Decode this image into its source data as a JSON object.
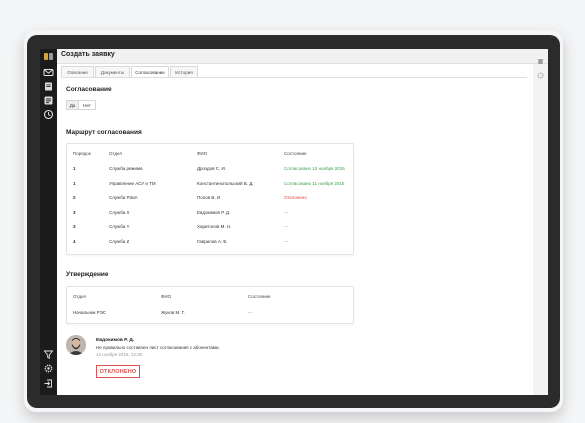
{
  "window": {
    "title": "Создать заявку"
  },
  "tabs": [
    "Описание",
    "Документы",
    "Согласование",
    "История"
  ],
  "active_tab": "Согласование",
  "approval": {
    "heading": "Согласование",
    "toggle": {
      "yes": "Да",
      "no": "Нет",
      "selected": "Да"
    }
  },
  "route": {
    "heading": "Маршрут согласования",
    "columns": [
      "Порядок",
      "Отдел",
      "ФИО",
      "Состояние"
    ],
    "rows": [
      {
        "order": "1",
        "dept": "Служба режима",
        "fio": "Дроздов С. И.",
        "status": "Согласовано 10 ноября 2016"
      },
      {
        "order": "1",
        "dept": "Управление АСУ и ТМ",
        "fio": "Константинопольский В. Д.",
        "status": "Согласовано 11 ноября 2016"
      },
      {
        "order": "2",
        "dept": "Служба РЗиА",
        "fio": "Попов В. И.",
        "status": "Отклонено"
      },
      {
        "order": "3",
        "dept": "Служба Х",
        "fio": "Евдокимов Р. Д.",
        "status": "—"
      },
      {
        "order": "3",
        "dept": "Служба Y",
        "fio": "Харитонов М. Н.",
        "status": "—"
      },
      {
        "order": "4",
        "dept": "Служба Z",
        "fio": "Гаврилов А. Б.",
        "status": "—"
      }
    ]
  },
  "confirm": {
    "heading": "Утверждение",
    "columns": [
      "Отдел",
      "ФИО",
      "Состояние"
    ],
    "row": {
      "dept": "Начальник РЭС",
      "fio": "Жуков М. Г.",
      "status": "—"
    }
  },
  "comment": {
    "author": "Евдокимов Р. Д.",
    "text": "Не правильно составлен лист согласования с абонентами.",
    "date": "12 ноября 2016, 12:30",
    "badge": "ОТКЛОНЕНО"
  },
  "colors": {
    "approved": "#3aa14a",
    "rejected": "#d34a3a",
    "stamp": "#d9534f"
  },
  "icons": {
    "sidebar_top": [
      "logo-icon",
      "mail-icon",
      "document-icon",
      "list-icon",
      "clock-icon"
    ],
    "sidebar_bottom": [
      "filter-icon",
      "settings-icon",
      "logout-icon"
    ]
  }
}
